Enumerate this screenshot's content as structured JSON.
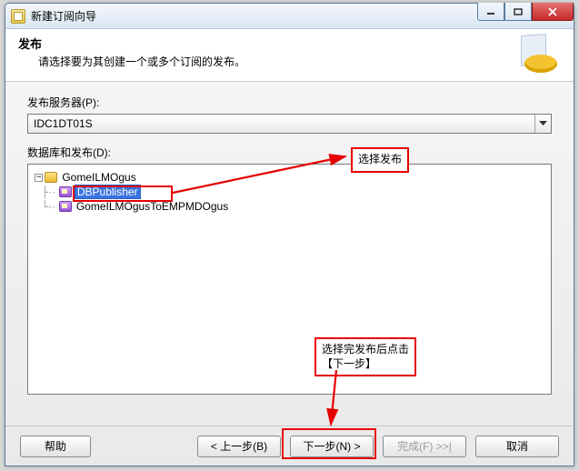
{
  "window": {
    "title": "新建订阅向导"
  },
  "header": {
    "title": "发布",
    "subtitle": "请选择要为其创建一个或多个订阅的发布。"
  },
  "publisher_section": {
    "label": "发布服务器(P):",
    "value": "IDC1DT01S"
  },
  "tree_section": {
    "label": "数据库和发布(D):",
    "root": {
      "label": "GomeILMOgus",
      "expand": "−"
    },
    "items": [
      {
        "label": "DBPublisher",
        "selected": true
      },
      {
        "label": "GomeILMOgusToEMPMDOgus",
        "selected": false
      }
    ]
  },
  "buttons": {
    "help": "帮助",
    "back": "< 上一步(B)",
    "next": "下一步(N) >",
    "finish": "完成(F) >>|",
    "cancel": "取消"
  },
  "annotations": {
    "a1": "选择发布",
    "a2_line1": "选择完发布后点击",
    "a2_line2": "【下一步】"
  }
}
